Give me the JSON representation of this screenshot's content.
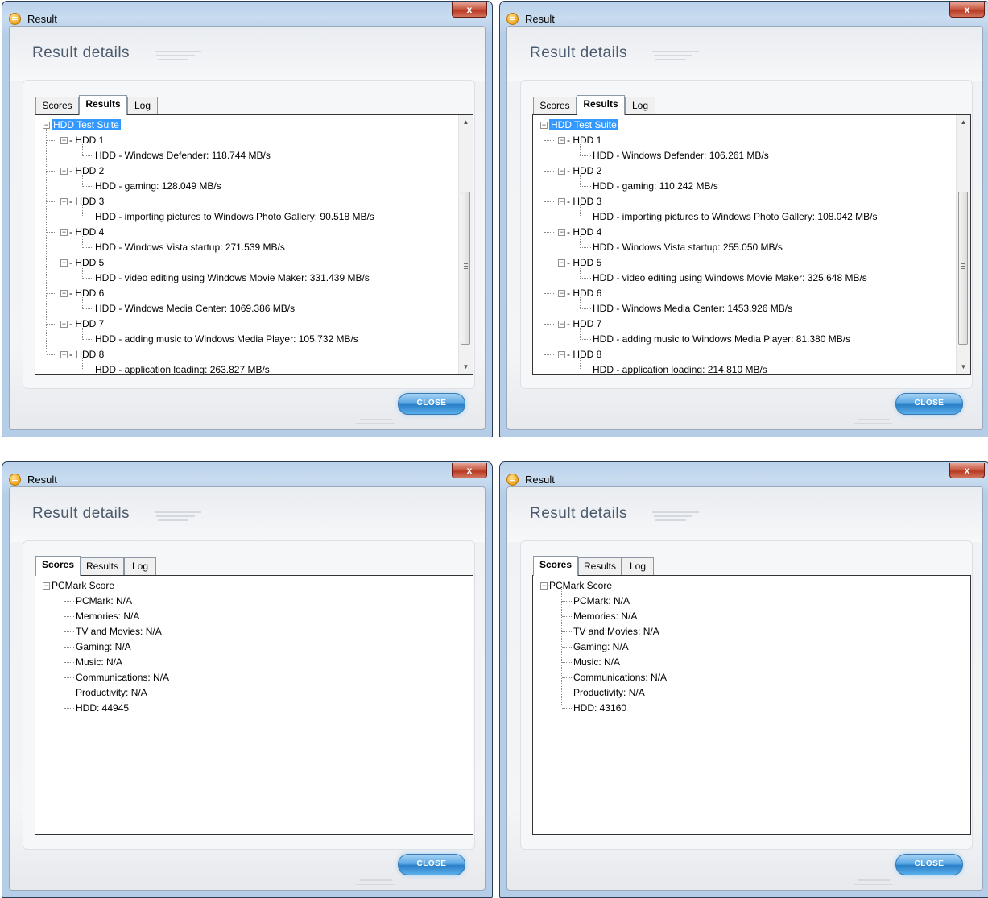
{
  "windows": [
    {
      "title": "Result",
      "header": "Result details",
      "tabs": [
        "Scores",
        "Results",
        "Log"
      ],
      "active_tab": "Results",
      "close_label": "CLOSE",
      "close_x": "x",
      "tree": {
        "root": "HDD Test Suite",
        "root_selected": true,
        "groups": [
          {
            "name": "HDD 1",
            "child": "HDD - Windows Defender: 118.744 MB/s"
          },
          {
            "name": "HDD 2",
            "child": "HDD - gaming: 128.049 MB/s"
          },
          {
            "name": "HDD 3",
            "child": "HDD - importing pictures to Windows Photo Gallery: 90.518 MB/s"
          },
          {
            "name": "HDD 4",
            "child": "HDD - Windows Vista startup: 271.539 MB/s"
          },
          {
            "name": "HDD 5",
            "child": "HDD - video editing using Windows Movie Maker: 331.439 MB/s"
          },
          {
            "name": "HDD 6",
            "child": "HDD - Windows Media Center: 1069.386 MB/s"
          },
          {
            "name": "HDD 7",
            "child": "HDD - adding music to Windows Media Player: 105.732 MB/s"
          },
          {
            "name": "HDD 8",
            "child": "HDD - application loading: 263.827 MB/s"
          }
        ]
      }
    },
    {
      "title": "Result",
      "header": "Result details",
      "tabs": [
        "Scores",
        "Results",
        "Log"
      ],
      "active_tab": "Results",
      "close_label": "CLOSE",
      "close_x": "x",
      "tree": {
        "root": "HDD Test Suite",
        "root_selected": true,
        "groups": [
          {
            "name": "HDD 1",
            "child": "HDD - Windows Defender: 106.261 MB/s"
          },
          {
            "name": "HDD 2",
            "child": "HDD - gaming: 110.242 MB/s"
          },
          {
            "name": "HDD 3",
            "child": "HDD - importing pictures to Windows Photo Gallery: 108.042 MB/s"
          },
          {
            "name": "HDD 4",
            "child": "HDD - Windows Vista startup: 255.050 MB/s"
          },
          {
            "name": "HDD 5",
            "child": "HDD - video editing using Windows Movie Maker: 325.648 MB/s"
          },
          {
            "name": "HDD 6",
            "child": "HDD - Windows Media Center: 1453.926 MB/s"
          },
          {
            "name": "HDD 7",
            "child": "HDD - adding music to Windows Media Player: 81.380 MB/s"
          },
          {
            "name": "HDD 8",
            "child": "HDD - application loading: 214.810 MB/s"
          }
        ]
      }
    },
    {
      "title": "Result",
      "header": "Result details",
      "tabs": [
        "Scores",
        "Results",
        "Log"
      ],
      "active_tab": "Scores",
      "close_label": "CLOSE",
      "close_x": "x",
      "tree": {
        "root": "PCMark Score",
        "root_selected": false,
        "items": [
          "PCMark: N/A",
          "Memories: N/A",
          "TV and Movies: N/A",
          "Gaming: N/A",
          "Music: N/A",
          "Communications: N/A",
          "Productivity: N/A",
          "HDD: 44945"
        ]
      }
    },
    {
      "title": "Result",
      "header": "Result details",
      "tabs": [
        "Scores",
        "Results",
        "Log"
      ],
      "active_tab": "Scores",
      "close_label": "CLOSE",
      "close_x": "x",
      "tree": {
        "root": "PCMark Score",
        "root_selected": false,
        "items": [
          "PCMark: N/A",
          "Memories: N/A",
          "TV and Movies: N/A",
          "Gaming: N/A",
          "Music: N/A",
          "Communications: N/A",
          "Productivity: N/A",
          "HDD: 43160"
        ]
      }
    }
  ]
}
